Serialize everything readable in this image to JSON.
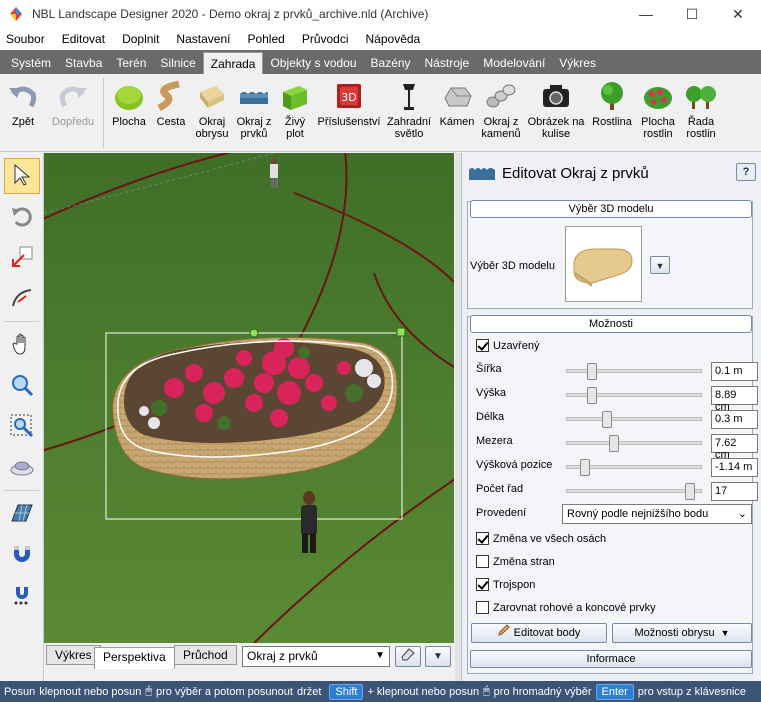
{
  "window": {
    "title": "NBL Landscape Designer 2020 - Demo okraj z prvků_archive.nld (Archive)",
    "minimize": "—",
    "maximize": "☐",
    "close": "✕"
  },
  "menu": [
    "Soubor",
    "Editovat",
    "Doplnit",
    "Nastavení",
    "Pohled",
    "Průvodci",
    "Nápověda"
  ],
  "ribbon_tabs": [
    "Systém",
    "Stavba",
    "Terén",
    "Silnice",
    "Zahrada",
    "Objekty s vodou",
    "Bazény",
    "Nástroje",
    "Modelování",
    "Výkres"
  ],
  "ribbon_active_tab": "Zahrada",
  "toolbar": {
    "undo": "Zpět",
    "redo": "Dopředu",
    "items": [
      {
        "l1": "Plocha",
        "l2": ""
      },
      {
        "l1": "Cesta",
        "l2": ""
      },
      {
        "l1": "Okraj",
        "l2": "obrysu"
      },
      {
        "l1": "Okraj z",
        "l2": "prvků"
      },
      {
        "l1": "Živý",
        "l2": "plot"
      },
      {
        "l1": "Příslušenství",
        "l2": ""
      },
      {
        "l1": "Zahradní",
        "l2": "světlo"
      },
      {
        "l1": "Kámen",
        "l2": ""
      },
      {
        "l1": "Okraj z",
        "l2": "kamenů"
      },
      {
        "l1": "Obrázek na",
        "l2": "kulise"
      },
      {
        "l1": "Rostlina",
        "l2": ""
      },
      {
        "l1": "Plocha",
        "l2": "rostlin"
      },
      {
        "l1": "Řada",
        "l2": "rostlin"
      }
    ]
  },
  "view_tabs": {
    "drawing": "Výkres",
    "perspective": "Perspektiva",
    "walk": "Průchod",
    "object_combo": "Okraj z prvků"
  },
  "panel": {
    "title": "Editovat Okraj z prvků",
    "help": "?",
    "model_group": "Výběr 3D modelu",
    "model_label": "Výběr 3D modelu",
    "options_group": "Možnosti",
    "closed_label": "Uzavřený",
    "closed": true,
    "params": [
      {
        "label": "Šířka",
        "value": "0.1 m",
        "pos": 0.15
      },
      {
        "label": "Výška",
        "value": "8.89 cm",
        "pos": 0.15
      },
      {
        "label": "Délka",
        "value": "0.3 m",
        "pos": 0.27
      },
      {
        "label": "Mezera",
        "value": "7.62 cm",
        "pos": 0.32
      },
      {
        "label": "Výšková pozice",
        "value": "-1.14 m",
        "pos": 0.12
      }
    ],
    "rows_label": "Počet řad",
    "rows_value": "17",
    "rows_pos": 0.9,
    "design_label": "Provedení",
    "design_value": "Rovný podle nejnižšího bodu",
    "checks": [
      {
        "label": "Změna ve všech osách",
        "checked": true
      },
      {
        "label": "Změna stran",
        "checked": false
      },
      {
        "label": "Trojspon",
        "checked": true
      },
      {
        "label": "Zarovnat rohové a koncové prvky",
        "checked": false
      }
    ],
    "edit_points": "Editovat body",
    "outline_options": "Možnosti obrysu",
    "info": "Informace"
  },
  "status": {
    "s1": "Posun",
    "s2": "klepnout nebo posun",
    "s3": "pro výběr a potom posunout",
    "s4": "držet",
    "key1": "Shift",
    "s5": "+ klepnout nebo posun",
    "s6": "pro hromadný výběr",
    "key2": "Enter",
    "s7": "pro vstup z klávesnice"
  },
  "colors": {
    "title_active_tab_bg": "#f0f0f0",
    "ribbon_bg": "#6a6a6a",
    "status_bg": "#3c5478",
    "grass": "#4a7a2d"
  }
}
